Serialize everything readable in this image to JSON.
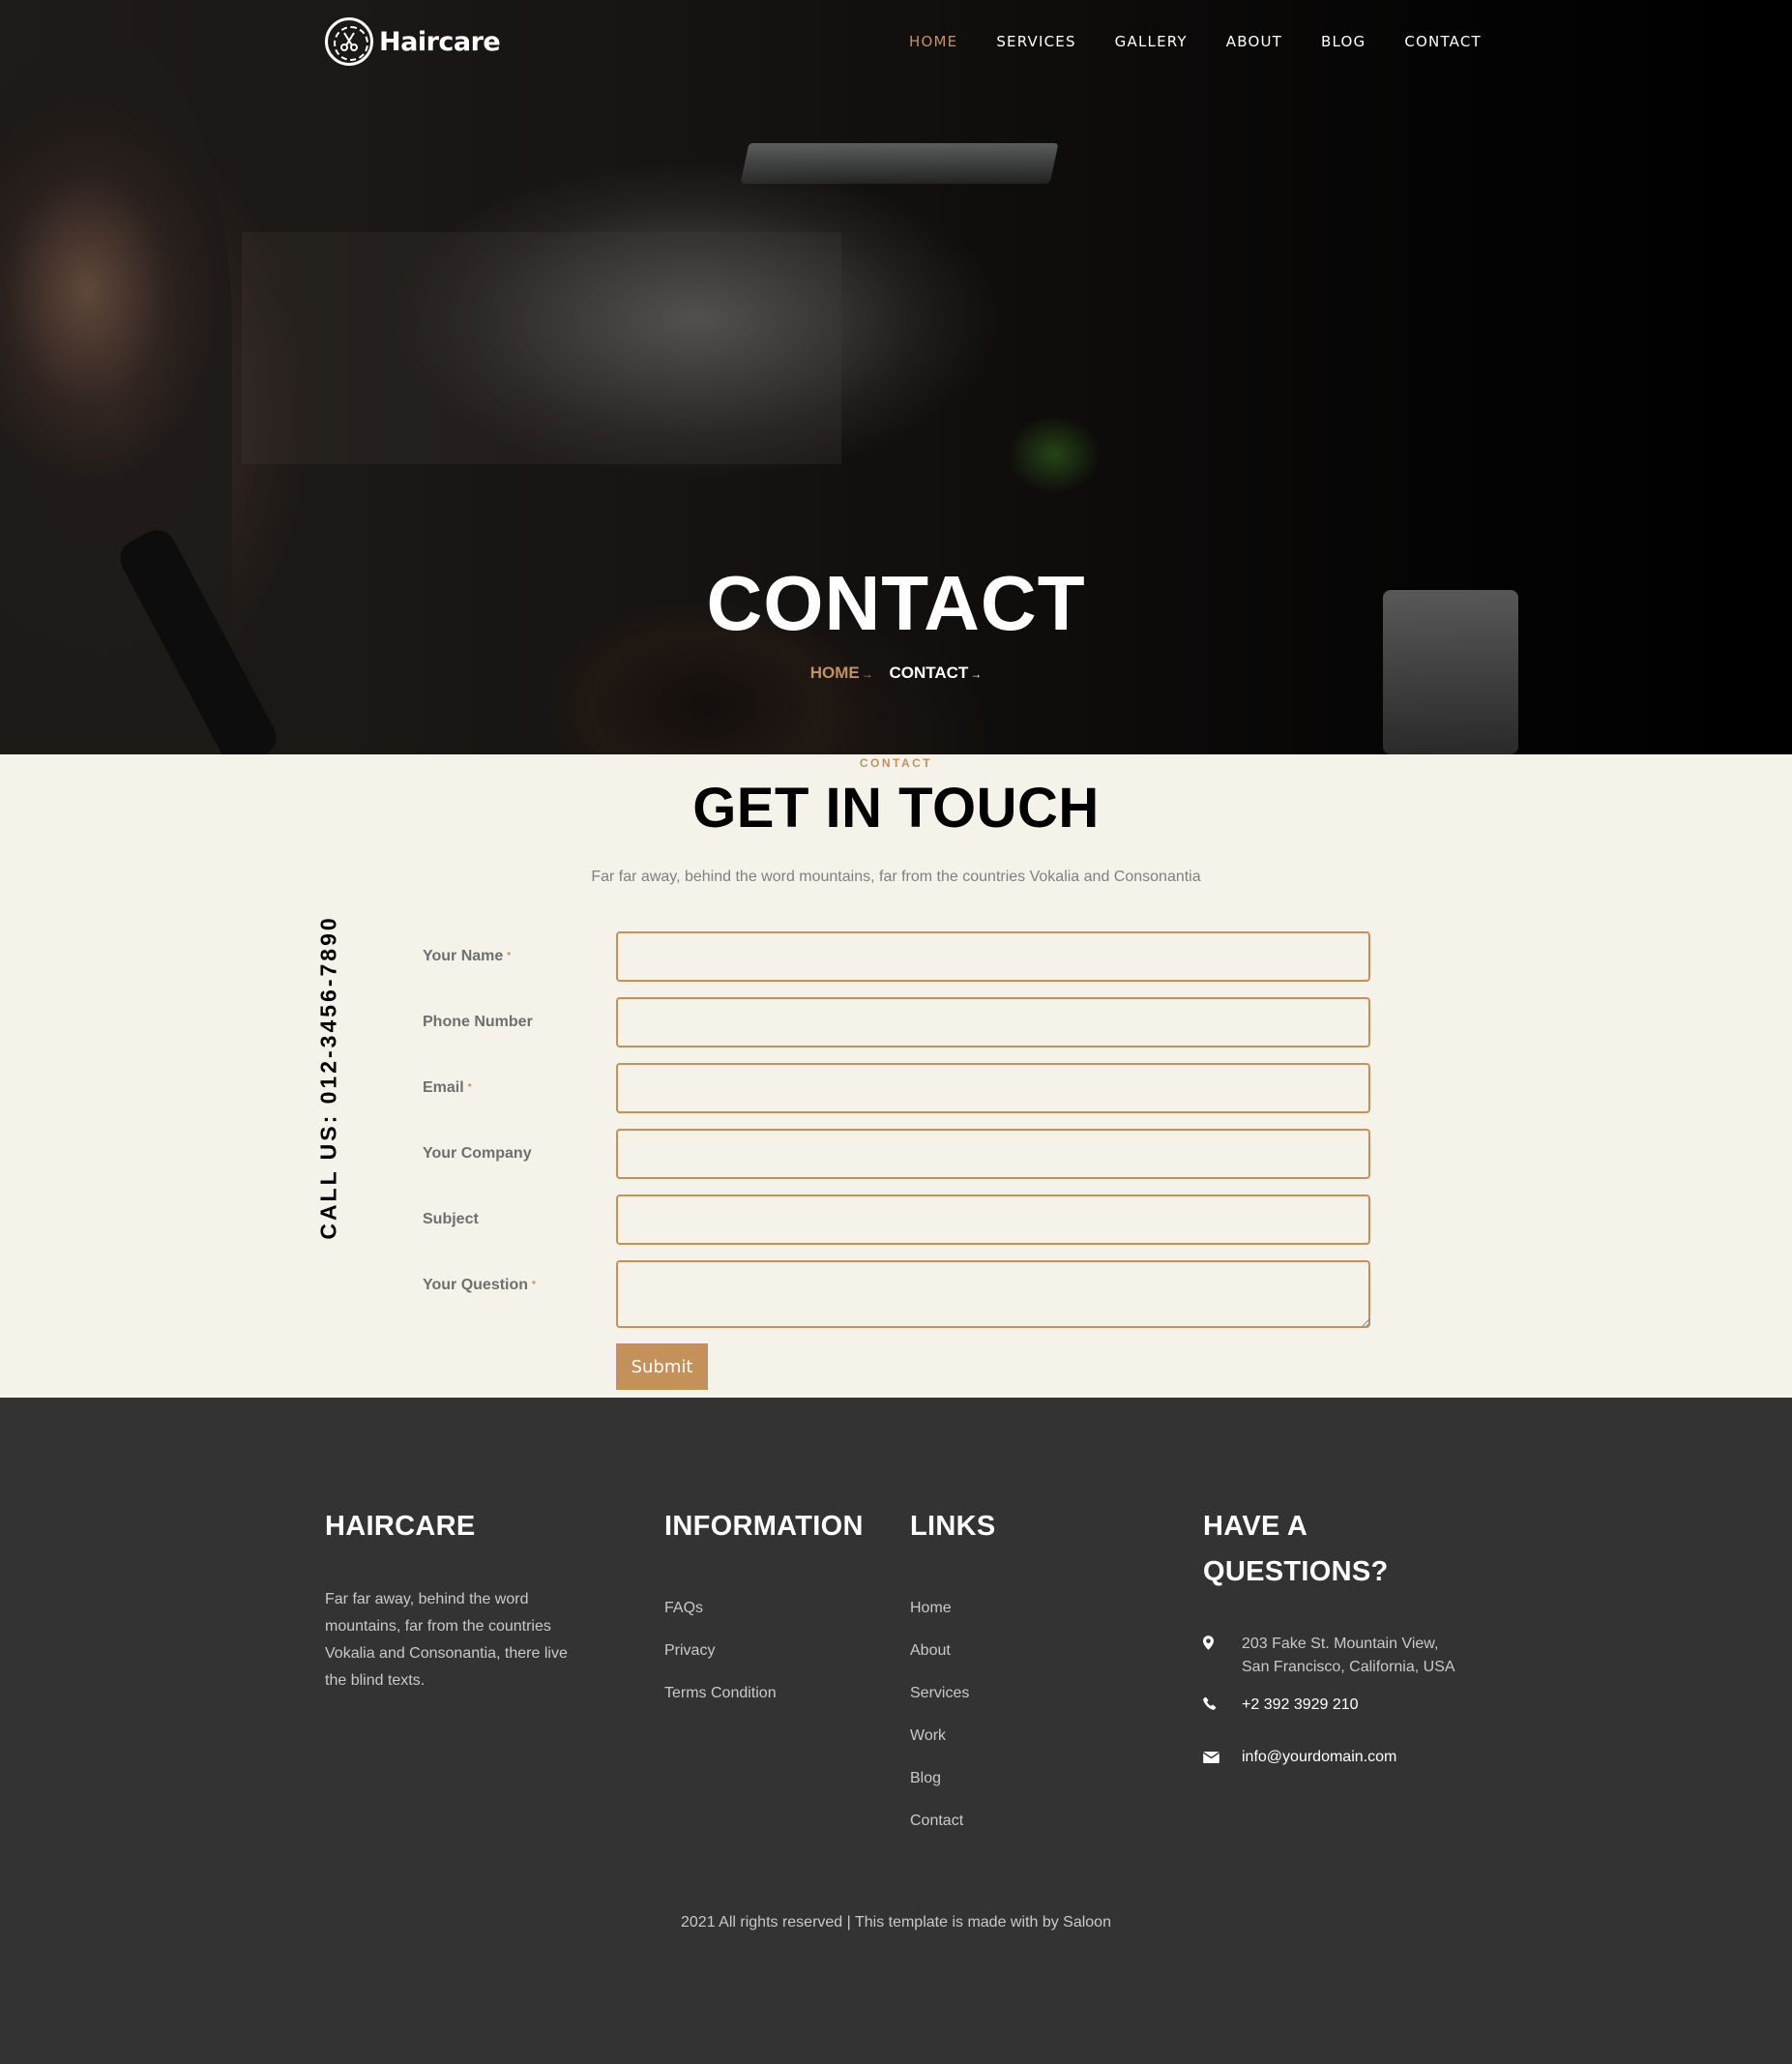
{
  "brand": {
    "logo_text": "Haircare"
  },
  "nav": {
    "items": [
      {
        "label": "HOME",
        "active": true
      },
      {
        "label": "SERVICES",
        "active": false
      },
      {
        "label": "GALLERY",
        "active": false
      },
      {
        "label": "ABOUT",
        "active": false
      },
      {
        "label": "BLOG",
        "active": false
      },
      {
        "label": "CONTACT",
        "active": false
      }
    ]
  },
  "hero": {
    "title": "CONTACT",
    "breadcrumb": {
      "home": "HOME",
      "current": "CONTACT",
      "separator": "→"
    }
  },
  "contact": {
    "eyebrow": "CONTACT",
    "title": "GET IN TOUCH",
    "subtitle": "Far far away, behind the word mountains, far from the countries Vokalia and Consonantia",
    "call_us": "CALL US: 012-3456-7890",
    "fields": [
      {
        "label": "Your Name",
        "required": true,
        "value": ""
      },
      {
        "label": "Phone Number",
        "required": false,
        "value": ""
      },
      {
        "label": "Email",
        "required": true,
        "value": ""
      },
      {
        "label": "Your Company",
        "required": false,
        "value": ""
      },
      {
        "label": "Subject",
        "required": false,
        "value": ""
      },
      {
        "label": "Your Question",
        "required": true,
        "value": ""
      }
    ],
    "required_marker": "*",
    "submit_label": "Submit"
  },
  "footer": {
    "about": {
      "heading": "HAIRCARE",
      "text": "Far far away, behind the word mountains, far from the countries Vokalia and Consonantia, there live the blind texts."
    },
    "information": {
      "heading": "INFORMATION",
      "links": [
        "FAQs",
        "Privacy",
        "Terms Condition"
      ]
    },
    "links": {
      "heading": "LINKS",
      "links": [
        "Home",
        "About",
        "Services",
        "Work",
        "Blog",
        "Contact"
      ]
    },
    "questions": {
      "heading_line1": "HAVE A",
      "heading_line2": "QUESTIONS?",
      "address_line1": "203 Fake St. Mountain View,",
      "address_line2": "San Francisco, California, USA",
      "phone": "+2 392 3929 210",
      "email": "info@yourdomain.com"
    },
    "copyright": "2021 All rights reserved | This template is made with by Saloon"
  },
  "colors": {
    "accent": "#c4915a",
    "section_bg": "#f5f2ea",
    "footer_bg": "#333333",
    "heading_dark": "#000000"
  },
  "icons": [
    "scissors-logo-icon",
    "map-pin-icon",
    "phone-icon",
    "envelope-icon"
  ]
}
